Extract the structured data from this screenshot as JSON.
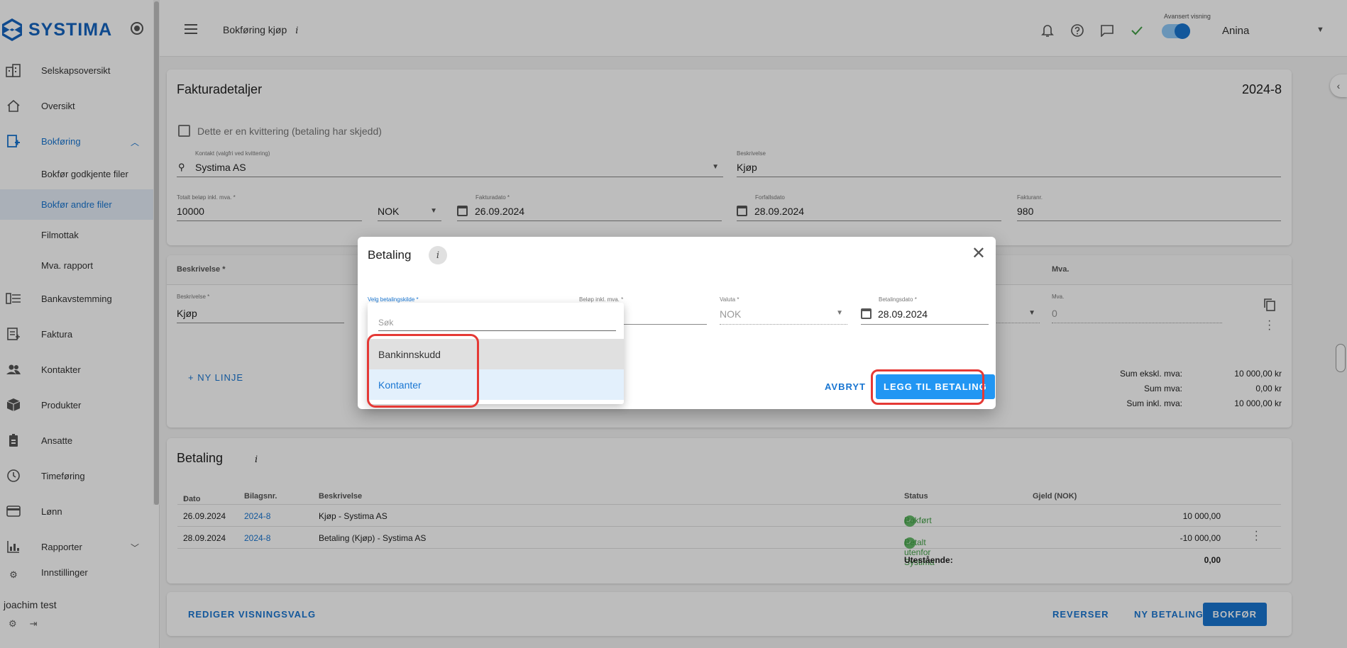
{
  "app": {
    "name": "SYSTIMA"
  },
  "sidebar": {
    "items": [
      {
        "label": "Selskapsoversikt",
        "icon": "company-icon"
      },
      {
        "label": "Oversikt",
        "icon": "home-icon"
      },
      {
        "label": "Bokføring",
        "icon": "bookkeeping-icon"
      },
      {
        "label": "Bankavstemming",
        "icon": "bank-icon"
      },
      {
        "label": "Faktura",
        "icon": "invoice-icon"
      },
      {
        "label": "Kontakter",
        "icon": "contacts-icon"
      },
      {
        "label": "Produkter",
        "icon": "products-icon"
      },
      {
        "label": "Ansatte",
        "icon": "employees-icon"
      },
      {
        "label": "Timeføring",
        "icon": "clock-icon"
      },
      {
        "label": "Lønn",
        "icon": "payroll-icon"
      },
      {
        "label": "Rapporter",
        "icon": "reports-icon"
      },
      {
        "label": "Innstillinger",
        "icon": "settings-icon"
      }
    ],
    "sub_items": [
      "Bokfør godkjente filer",
      "Bokfør andre filer",
      "Filmottak",
      "Mva. rapport"
    ],
    "user": "joachim test"
  },
  "topbar": {
    "title": "Bokføring kjøp",
    "info": "i",
    "advanced_label": "Avansert visning",
    "user": "Anina"
  },
  "invoice": {
    "heading": "Fakturadetaljer",
    "number": "2024-8",
    "receipt_label": "Dette er en kvittering (betaling har skjedd)",
    "contact_label": "Kontakt (valgfri ved kvittering)",
    "contact_value": "Systima AS",
    "desc_label": "Beskrivelse",
    "desc_value": "Kjøp",
    "total_label": "Totalt beløp inkl. mva. *",
    "total_value": "10000",
    "currency": "NOK",
    "date_label": "Fakturadato *",
    "date_value": "26.09.2024",
    "due_label": "Forfallsdato",
    "due_value": "28.09.2024",
    "invno_label": "Fakturanr.",
    "invno_value": "980"
  },
  "lines": {
    "col_desc": "Beskrivelse *",
    "col_mva": "Mva.",
    "row_desc_label": "Beskrivelse *",
    "row_desc_value": "Kjøp",
    "row_mva_label": "Mva.",
    "row_mva_value": "0",
    "new_line": "+ NY LINJE",
    "sums": [
      {
        "k": "Sum ekskl. mva:",
        "v": "10 000,00 kr"
      },
      {
        "k": "Sum mva:",
        "v": "0,00 kr"
      },
      {
        "k": "Sum inkl. mva:",
        "v": "10 000,00 kr"
      }
    ]
  },
  "payment": {
    "heading": "Betaling",
    "info": "i",
    "headers": {
      "date": "Dato",
      "voucher": "Bilagsnr.",
      "desc": "Beskrivelse",
      "status": "Status",
      "debt": "Gjeld (NOK)"
    },
    "rows": [
      {
        "date": "26.09.2024",
        "voucher": "2024-8",
        "desc": "Kjøp - Systima AS",
        "status": "Bokført",
        "debt": "10 000,00"
      },
      {
        "date": "28.09.2024",
        "voucher": "2024-8",
        "desc": "Betaling (Kjøp) - Systima AS",
        "status": "Betalt utenfor Systima",
        "debt": "-10 000,00"
      }
    ],
    "outstanding_label": "Utestående:",
    "outstanding_value": "0,00"
  },
  "footer": {
    "edit_view": "REDIGER VISNINGSVALG",
    "reverse": "REVERSER",
    "new_payment": "NY BETALING",
    "post": "BOKFØR"
  },
  "dialog": {
    "title": "Betaling",
    "info": "i",
    "source_label": "Velg betalingskilde *",
    "amount_label": "Beløp inkl. mva. *",
    "currency_label": "Valuta *",
    "currency_value": "NOK",
    "paydate_label": "Betalingsdato *",
    "paydate_value": "28.09.2024",
    "cancel": "AVBRYT",
    "add": "LEGG TIL BETALING"
  },
  "dropdown": {
    "search_placeholder": "Søk",
    "options": [
      "Bankinnskudd",
      "Kontanter"
    ]
  },
  "colors": {
    "accent": "#1976d2",
    "highlight": "#e53935",
    "success": "#43a047"
  }
}
